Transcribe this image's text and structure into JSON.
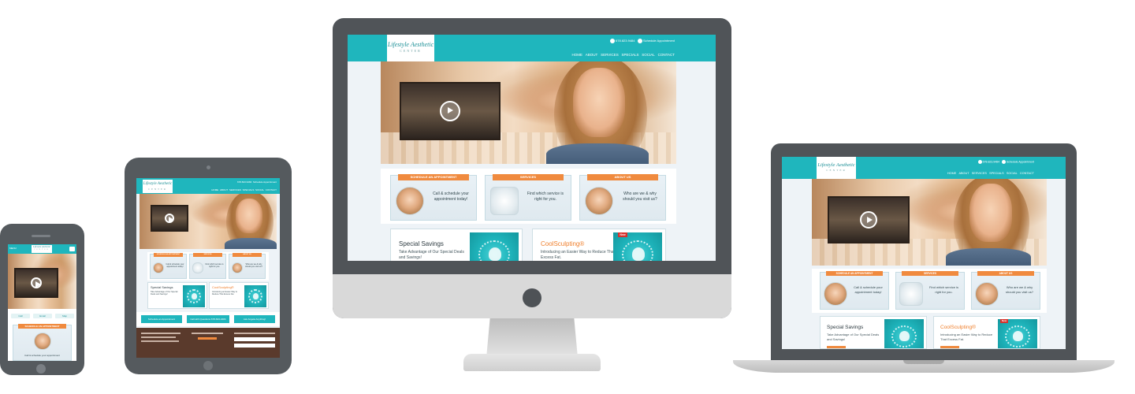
{
  "brand": {
    "logo_line1": "Lifestyle Aesthetic",
    "logo_line2": "CENTER",
    "accent_color": "#1fb6bd",
    "orange_color": "#f08a3e"
  },
  "header": {
    "phone": "678.823.9484",
    "schedule": "Schedule Appointment"
  },
  "nav": {
    "items": [
      "HOME",
      "ABOUT",
      "SERVICES",
      "SPECIALS",
      "SOCIAL",
      "CONTACT"
    ]
  },
  "cards": [
    {
      "ribbon": "SCHEDULE AN APPOINTMENT",
      "text": "Call & schedule your appointment today!"
    },
    {
      "ribbon": "SERVICES",
      "text": "Find which service is right for you."
    },
    {
      "ribbon": "ABOUT US",
      "text": "Who are we & why should you visit us?"
    }
  ],
  "promos": [
    {
      "title": "Special Savings",
      "text": "Take Advantage of Our Special Deals and Savings!"
    },
    {
      "title": "CoolSculpting®",
      "text": "Introducing an Easier Way to Reduce That Excess Fat.",
      "badge": "New"
    }
  ],
  "tablet": {
    "cta": [
      "Schedule an Appointment",
      "Call with Questions 678-823-9484",
      "Ask Angela Anything!"
    ]
  },
  "phone_view": {
    "menu_label": "MENU",
    "actions": [
      "Call",
      "Email",
      "Map"
    ],
    "ribbon": "SCHEDULE AN APPOINTMENT",
    "text": "Call & schedule your appointment"
  }
}
